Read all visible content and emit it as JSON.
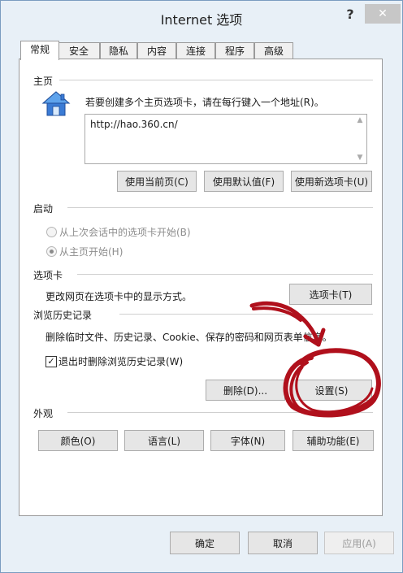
{
  "window": {
    "title": "Internet 选项",
    "help": "?",
    "close": "✕"
  },
  "tabs": [
    "常规",
    "安全",
    "隐私",
    "内容",
    "连接",
    "程序",
    "高级"
  ],
  "homepage": {
    "section_title": "主页",
    "description": "若要创建多个主页选项卡，请在每行键入一个地址(R)。",
    "url": "http://hao.360.cn/",
    "use_current": "使用当前页(C)",
    "use_default": "使用默认值(F)",
    "use_new_tab": "使用新选项卡(U)"
  },
  "startup": {
    "section_title": "启动",
    "option_last_session": "从上次会话中的选项卡开始(B)",
    "option_homepage": "从主页开始(H)",
    "selected": "option_homepage"
  },
  "tabs_section": {
    "section_title": "选项卡",
    "description": "更改网页在选项卡中的显示方式。",
    "tabs_button": "选项卡(T)"
  },
  "history": {
    "section_title": "浏览历史记录",
    "description": "删除临时文件、历史记录、Cookie、保存的密码和网页表单信息。",
    "delete_on_exit": "退出时删除浏览历史记录(W)",
    "delete_on_exit_checked": true,
    "delete_button": "删除(D)...",
    "settings_button": "设置(S)"
  },
  "appearance": {
    "section_title": "外观",
    "colors": "颜色(O)",
    "languages": "语言(L)",
    "fonts": "字体(N)",
    "accessibility": "辅助功能(E)"
  },
  "footer": {
    "ok": "确定",
    "cancel": "取消",
    "apply": "应用(A)"
  },
  "colors": {
    "annotation": "#b0101c"
  }
}
